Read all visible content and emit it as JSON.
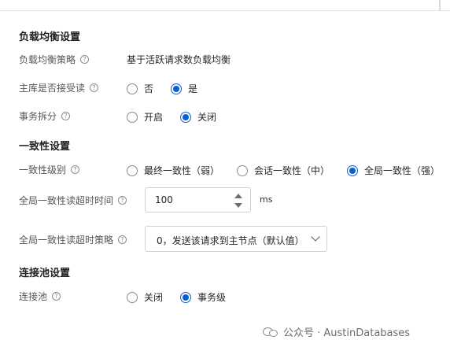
{
  "sections": {
    "load_balancing": {
      "title": "负载均衡设置",
      "policy_label": "负载均衡策略",
      "policy_value": "基于活跃请求数负载均衡",
      "primary_read_label": "主库是否接受读",
      "primary_read_options": [
        "否",
        "是"
      ],
      "primary_read_selected": "是",
      "txn_split_label": "事务拆分",
      "txn_split_options": [
        "开启",
        "关闭"
      ],
      "txn_split_selected": "关闭"
    },
    "consistency": {
      "title": "一致性设置",
      "level_label": "一致性级别",
      "level_options": [
        "最终一致性（弱）",
        "会话一致性（中）",
        "全局一致性（强）"
      ],
      "level_selected": "全局一致性（强）",
      "timeout_label": "全局一致性读超时时间",
      "timeout_value": "100",
      "timeout_unit": "ms",
      "timeout_policy_label": "全局一致性读超时策略",
      "timeout_policy_value": "0，发送该请求到主节点（默认值）"
    },
    "pool": {
      "title": "连接池设置",
      "pool_label": "连接池",
      "pool_options": [
        "关闭",
        "事务级"
      ],
      "pool_selected": "事务级"
    }
  },
  "help_glyph": "?",
  "watermark": {
    "text": "公众号 · AustinDatabases",
    "icon": "wechat-icon"
  },
  "colors": {
    "accent": "#0a5fcf",
    "text": "#262626",
    "label": "#555555",
    "border": "#d0d0d0"
  }
}
